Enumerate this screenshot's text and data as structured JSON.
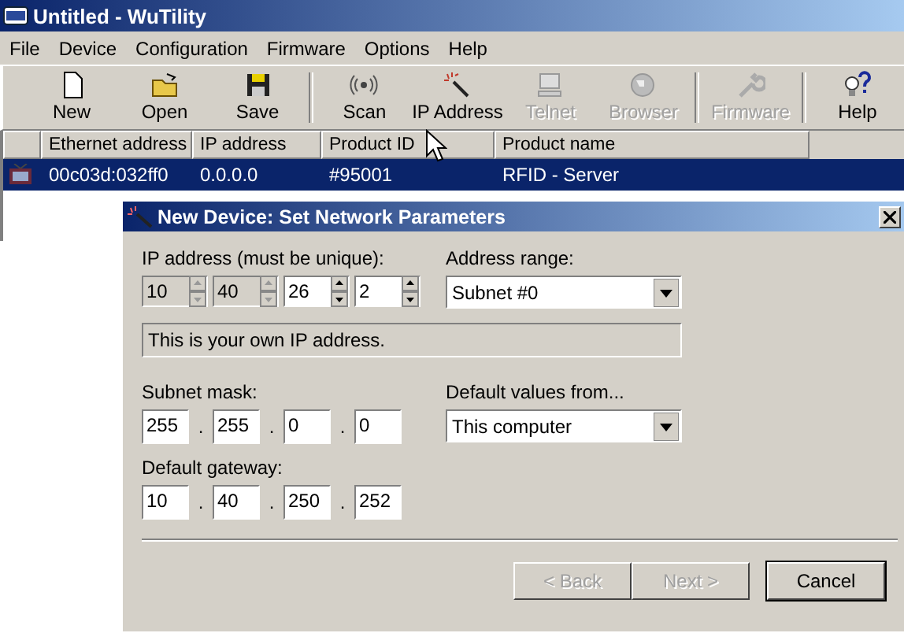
{
  "window": {
    "title": "Untitled - WuTility"
  },
  "menu": [
    "File",
    "Device",
    "Configuration",
    "Firmware",
    "Options",
    "Help"
  ],
  "toolbar": [
    {
      "label": "New",
      "disabled": false
    },
    {
      "label": "Open",
      "disabled": false
    },
    {
      "label": "Save",
      "disabled": false
    },
    {
      "label": "Scan",
      "disabled": false
    },
    {
      "label": "IP Address",
      "disabled": false
    },
    {
      "label": "Telnet",
      "disabled": true
    },
    {
      "label": "Browser",
      "disabled": true
    },
    {
      "label": "Firmware",
      "disabled": true
    },
    {
      "label": "Help",
      "disabled": false
    }
  ],
  "table": {
    "columns": [
      "Ethernet address",
      "IP address",
      "Product ID",
      "Product name"
    ],
    "rows": [
      {
        "cells": [
          "00c03d:032ff0",
          "0.0.0.0",
          "#95001",
          "RFID - Server"
        ],
        "selected": true
      }
    ]
  },
  "dialog": {
    "title": "New Device: Set Network Parameters",
    "ip_label": "IP address (must be unique):",
    "ip_fields": [
      {
        "value": "10",
        "disabled": true
      },
      {
        "value": "40",
        "disabled": true
      },
      {
        "value": "26",
        "disabled": false
      },
      {
        "value": "2",
        "disabled": false
      }
    ],
    "address_range_label": "Address range:",
    "address_range": "Subnet #0",
    "info": "This is your own IP address.",
    "subnet_label": "Subnet mask:",
    "subnet_fields": [
      "255",
      "255",
      "0",
      "0"
    ],
    "subnet_separators": [
      ".",
      ".",
      "."
    ],
    "defaults_label": "Default values from...",
    "defaults": "This computer",
    "gateway_label": "Default gateway:",
    "gateway_fields": [
      "10",
      "40",
      "250",
      "252"
    ],
    "gateway_separators": [
      ".",
      ".",
      "."
    ],
    "buttons": [
      {
        "label": "< Back",
        "disabled": true
      },
      {
        "label": "Next >",
        "disabled": true
      },
      {
        "label": "Cancel",
        "disabled": false
      }
    ]
  }
}
